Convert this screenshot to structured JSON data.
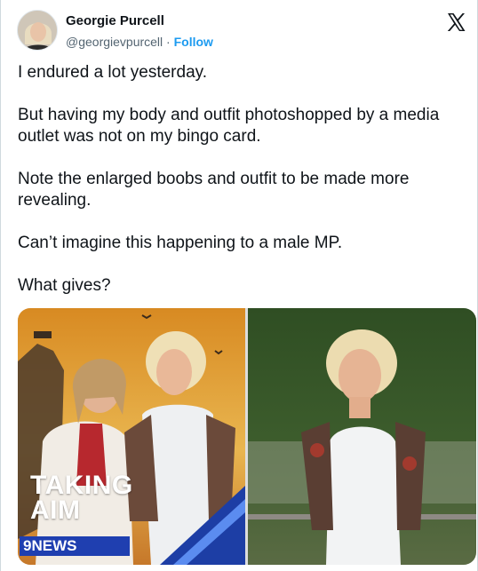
{
  "tweet": {
    "author_name": "Georgie Purcell",
    "author_handle": "@georgievpurcell",
    "separator": " · ",
    "follow_label": "Follow",
    "paragraphs": [
      "I endured a lot yesterday.",
      "But having my body and outfit photoshopped by a media outlet was not on my bingo card.",
      "Note the enlarged boobs and outfit to be made more revealing.",
      "Can’t imagine this happening to a male MP.",
      "What gives?"
    ]
  },
  "media": {
    "left_image": {
      "overlay_title_line1": "TAKING",
      "overlay_title_line2": "AIM",
      "news_badge": "9NEWS"
    }
  },
  "icons": {
    "platform_logo": "x-logo-icon",
    "news_logo": "nine-news-logo-icon"
  },
  "colors": {
    "link_blue": "#1d9bf0",
    "text_primary": "#0f1419",
    "text_secondary": "#536471",
    "news_blue": "#1f3fb0"
  }
}
